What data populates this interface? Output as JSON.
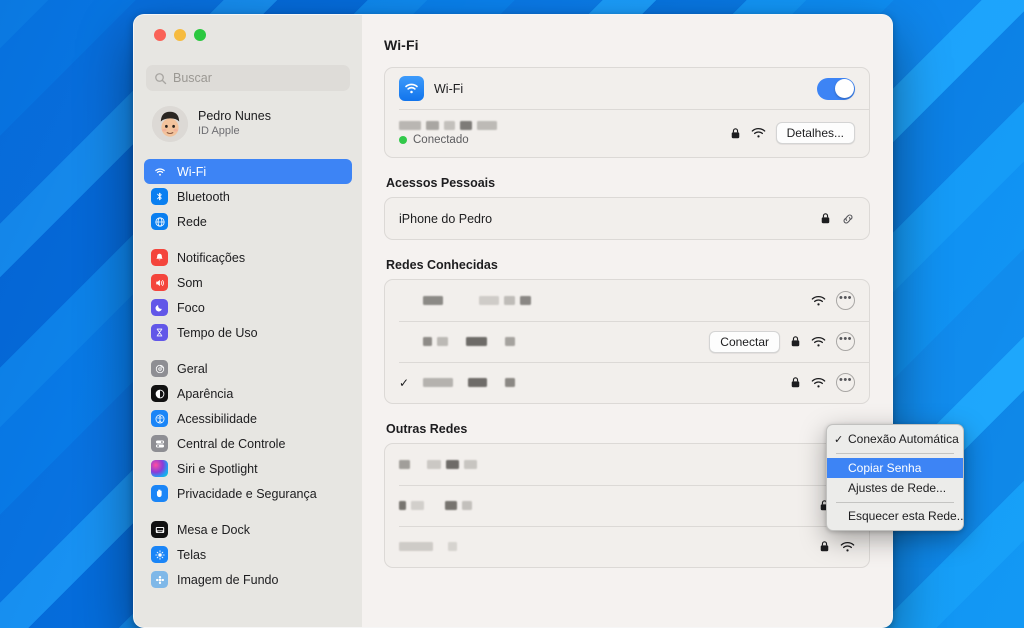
{
  "window": {
    "traffic_lights": [
      "close",
      "minimize",
      "zoom"
    ]
  },
  "sidebar": {
    "search": {
      "placeholder": "Buscar",
      "value": ""
    },
    "account": {
      "name": "Pedro Nunes",
      "subtitle": "ID Apple"
    },
    "groups": [
      {
        "items": [
          {
            "label": "Wi-Fi",
            "icon": "wifi-icon",
            "selected": true
          },
          {
            "label": "Bluetooth",
            "icon": "bluetooth-icon",
            "selected": false
          },
          {
            "label": "Rede",
            "icon": "globe-icon",
            "selected": false
          }
        ]
      },
      {
        "items": [
          {
            "label": "Notificações",
            "icon": "bell-icon",
            "selected": false
          },
          {
            "label": "Som",
            "icon": "speaker-icon",
            "selected": false
          },
          {
            "label": "Foco",
            "icon": "moon-icon",
            "selected": false
          },
          {
            "label": "Tempo de Uso",
            "icon": "hourglass-icon",
            "selected": false
          }
        ]
      },
      {
        "items": [
          {
            "label": "Geral",
            "icon": "gear-icon",
            "selected": false
          },
          {
            "label": "Aparência",
            "icon": "appearance-icon",
            "selected": false
          },
          {
            "label": "Acessibilidade",
            "icon": "accessibility-icon",
            "selected": false
          },
          {
            "label": "Central de Controle",
            "icon": "control-center-icon",
            "selected": false
          },
          {
            "label": "Siri e Spotlight",
            "icon": "siri-icon",
            "selected": false
          },
          {
            "label": "Privacidade e Segurança",
            "icon": "hand-icon",
            "selected": false
          }
        ]
      },
      {
        "items": [
          {
            "label": "Mesa e Dock",
            "icon": "desktop-dock-icon",
            "selected": false
          },
          {
            "label": "Telas",
            "icon": "display-icon",
            "selected": false
          },
          {
            "label": "Imagem de Fundo",
            "icon": "wallpaper-icon",
            "selected": false
          }
        ]
      }
    ]
  },
  "main": {
    "title": "Wi-Fi",
    "wifi_toggle": {
      "label": "Wi-Fi",
      "state": "on"
    },
    "current_network": {
      "name_redacted": true,
      "status": "Conectado",
      "details_button": "Detalhes...",
      "locked": true
    },
    "sections": [
      {
        "heading": "Acessos Pessoais",
        "rows": [
          {
            "name": "iPhone do Pedro",
            "redacted": false,
            "locked": true,
            "link": true
          }
        ]
      },
      {
        "heading": "Redes Conhecidas",
        "rows": [
          {
            "name": "",
            "redacted": true,
            "locked": false,
            "connect_button": "",
            "checked": false
          },
          {
            "name": "",
            "redacted": true,
            "locked": true,
            "connect_button": "Conectar",
            "checked": false
          },
          {
            "name": "",
            "redacted": true,
            "locked": true,
            "connect_button": "",
            "checked": true
          }
        ]
      },
      {
        "heading": "Outras Redes",
        "rows": [
          {
            "name": "",
            "redacted": true,
            "locked": false
          },
          {
            "name": "",
            "redacted": true,
            "locked": true
          },
          {
            "name": "",
            "redacted": true,
            "locked": true
          }
        ]
      }
    ]
  },
  "context_menu": {
    "items": [
      {
        "label": "Conexão Automática",
        "checked": true,
        "highlighted": false
      },
      {
        "label": "Copiar Senha",
        "checked": false,
        "highlighted": true
      },
      {
        "label": "Ajustes de Rede...",
        "checked": false,
        "highlighted": false
      },
      {
        "label": "Esquecer esta Rede...",
        "checked": false,
        "highlighted": false
      }
    ]
  },
  "colors": {
    "accent_blue": "#3d84f5",
    "toggle_on": "#3d84f5",
    "status_green": "#32c94a",
    "window_bg": "#f5f2f0",
    "sidebar_bg": "#e7e6e2"
  }
}
